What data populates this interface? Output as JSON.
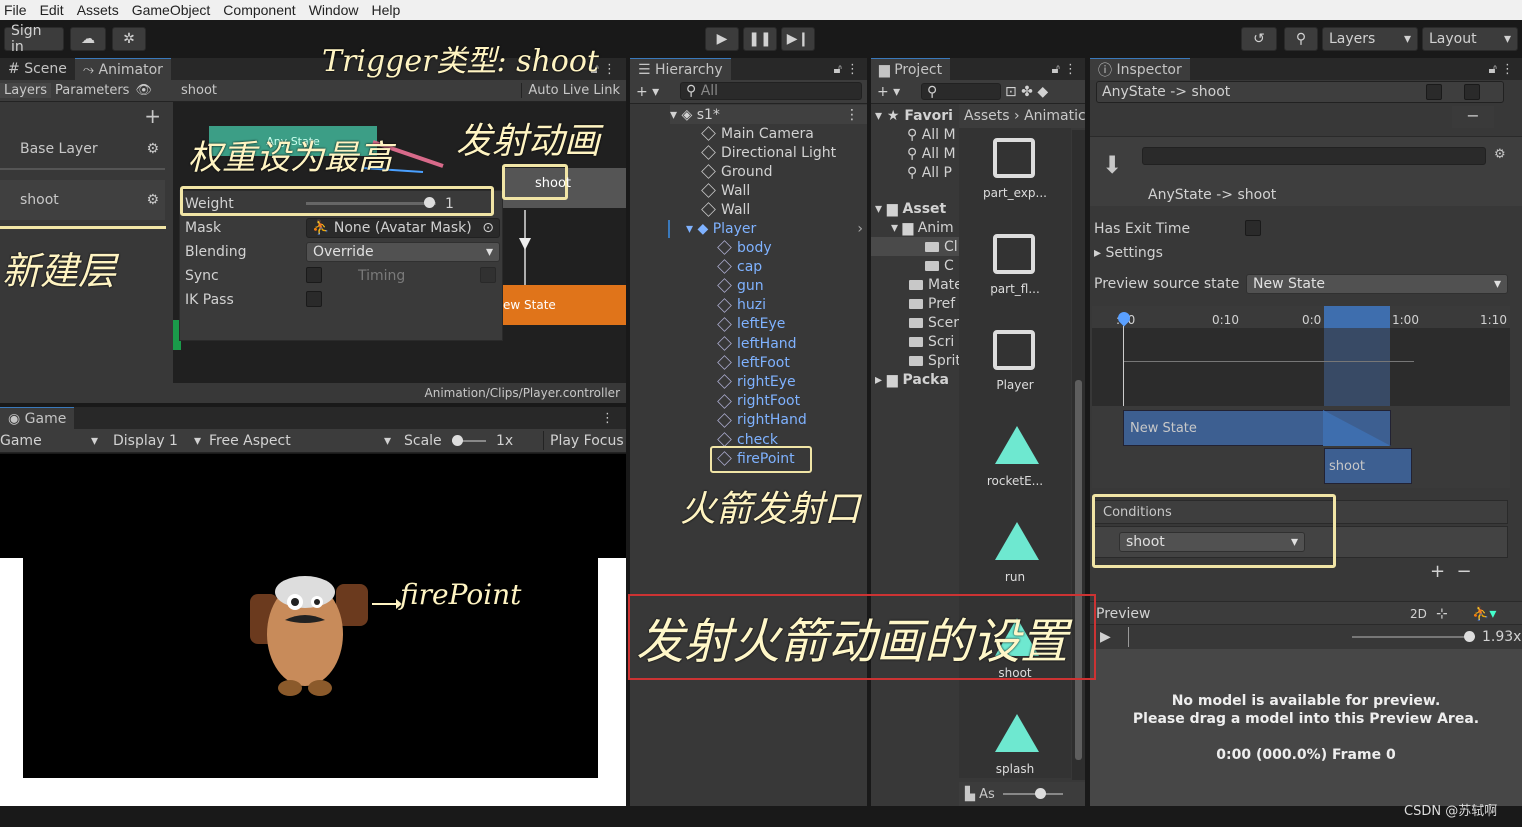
{
  "menu": [
    "File",
    "Edit",
    "Assets",
    "GameObject",
    "Component",
    "Window",
    "Help"
  ],
  "toolbar": {
    "sign_in": "Sign in",
    "layers": "Layers",
    "layout": "Layout"
  },
  "scene_tab": "Scene",
  "animator_tab": "Animator",
  "animator": {
    "layers_tab": "Layers",
    "parameters_tab": "Parameters",
    "breadcrumb": "shoot",
    "auto_live_link": "Auto Live Link",
    "layers": [
      "Base Layer",
      "shoot"
    ],
    "state_any": "Any State",
    "state_shoot": "shoot",
    "state_new": "ew State",
    "path": "Animation/Clips/Player.controller",
    "popup": {
      "weight_label": "Weight",
      "weight_value": "1",
      "mask_label": "Mask",
      "mask_value": "None (Avatar Mask)",
      "blending_label": "Blending",
      "blending_value": "Override",
      "sync_label": "Sync",
      "timing_label": "Timing",
      "ikpass_label": "IK Pass"
    }
  },
  "game": {
    "tab": "Game",
    "mode": "Game",
    "display": "Display 1",
    "aspect": "Free Aspect",
    "scale_label": "Scale",
    "scale_value": "1x",
    "play_focus": "Play Focus"
  },
  "hierarchy": {
    "tab": "Hierarchy",
    "search_placeholder": "All",
    "scene": "s1*",
    "items": [
      "Main Camera",
      "Directional Light",
      "Ground",
      "Wall",
      "Wall"
    ],
    "player": "Player",
    "children": [
      "body",
      "cap",
      "gun",
      "huzi",
      "leftEye",
      "leftHand",
      "leftFoot",
      "rightEye",
      "rightFoot",
      "rightHand",
      "check",
      "firePoint"
    ]
  },
  "project": {
    "tab": "Project",
    "favorites": "Favori",
    "fav_items": [
      "All M",
      "All M",
      "All P"
    ],
    "assets": "Asset",
    "anim": "Anim",
    "sub": [
      "Cl",
      "C"
    ],
    "folders": [
      "Mate",
      "Pref",
      "Scer",
      "Scri",
      "Sprit"
    ],
    "packages": "Packa",
    "breadcrumb_assets": "Assets",
    "breadcrumb_anim": "Animatic",
    "grid": [
      "part_exp...",
      "part_fl...",
      "Player",
      "rocketE...",
      "run",
      "shoot",
      "splash"
    ],
    "bottom": "As"
  },
  "inspector": {
    "tab": "Inspector",
    "transition_header": "AnyState -> shoot",
    "transition_title": "AnyState -> shoot",
    "has_exit_time": "Has Exit Time",
    "settings": "Settings",
    "preview_source_label": "Preview source state",
    "preview_source_value": "New State",
    "ticks": [
      ":00",
      "0:10",
      "0:0",
      "1:00",
      "1:10"
    ],
    "track_new_state": "New State",
    "track_shoot": "shoot",
    "conditions": "Conditions",
    "condition_value": "shoot",
    "preview": "Preview",
    "preview_2d": "2D",
    "preview_speed": "1.93x",
    "no_model_1": "No model is available for preview.",
    "no_model_2": "Please drag a model into this Preview Area.",
    "frame": "0:00 (000.0%) Frame 0"
  },
  "annotations": {
    "trigger": "Trigger类型: shoot",
    "weight": "权重设为最高",
    "anim": "发射动画",
    "new_layer": "新建层",
    "firepoint_zh": "火箭发射口",
    "firepoint_en": "firePoint",
    "settings": "发射火箭动画的设置"
  },
  "watermark": "CSDN @苏轼啊"
}
